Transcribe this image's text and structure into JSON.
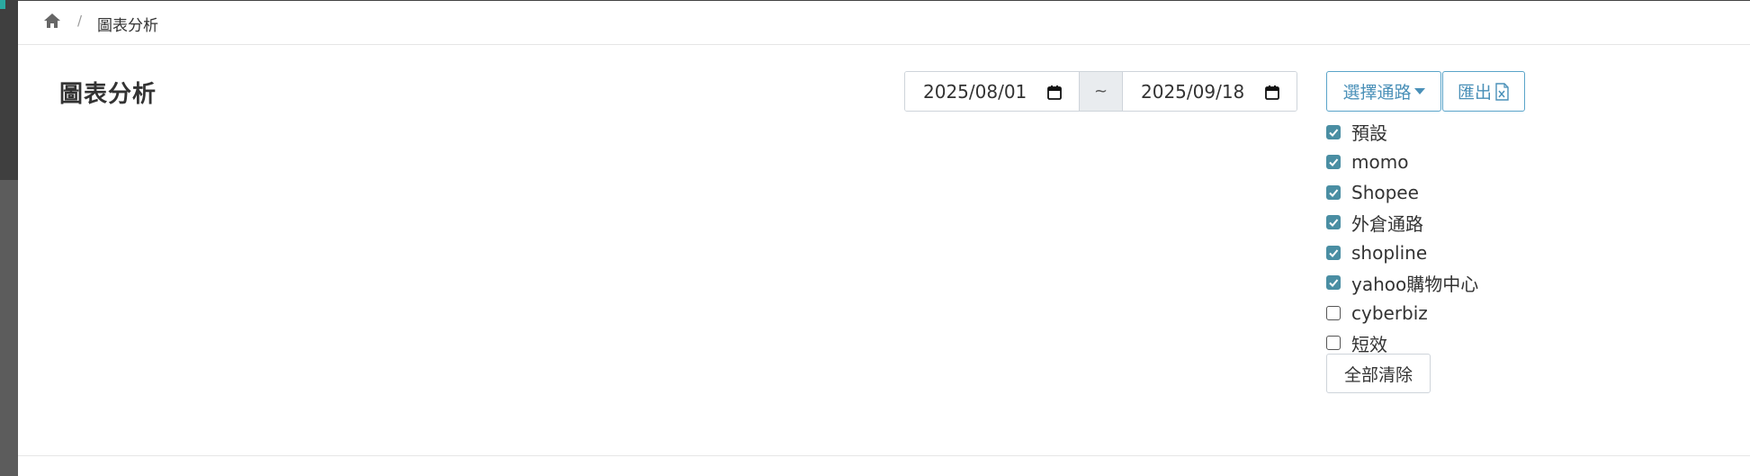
{
  "breadcrumb": {
    "home_icon": "home-icon",
    "separator": "/",
    "current": "圖表分析"
  },
  "page": {
    "title": "圖表分析"
  },
  "date_range": {
    "start": "2025/08/01",
    "separator": "~",
    "end": "2025/09/18",
    "icon": "calendar-icon"
  },
  "actions": {
    "select_channel_label": "選擇通路",
    "export_label": "匯出",
    "export_icon": "excel-file-icon",
    "clear_all_label": "全部清除"
  },
  "channels": [
    {
      "label": "預設",
      "checked": true
    },
    {
      "label": "momo",
      "checked": true
    },
    {
      "label": "Shopee",
      "checked": true
    },
    {
      "label": "外倉通路",
      "checked": true
    },
    {
      "label": "shopline",
      "checked": true
    },
    {
      "label": "yahoo購物中心",
      "checked": true
    },
    {
      "label": "cyberbiz",
      "checked": false
    },
    {
      "label": "短效",
      "checked": false
    }
  ],
  "colors": {
    "accent": "#4a90b8",
    "checkbox_checked": "#4a8ea3",
    "title_text": "#333333"
  }
}
